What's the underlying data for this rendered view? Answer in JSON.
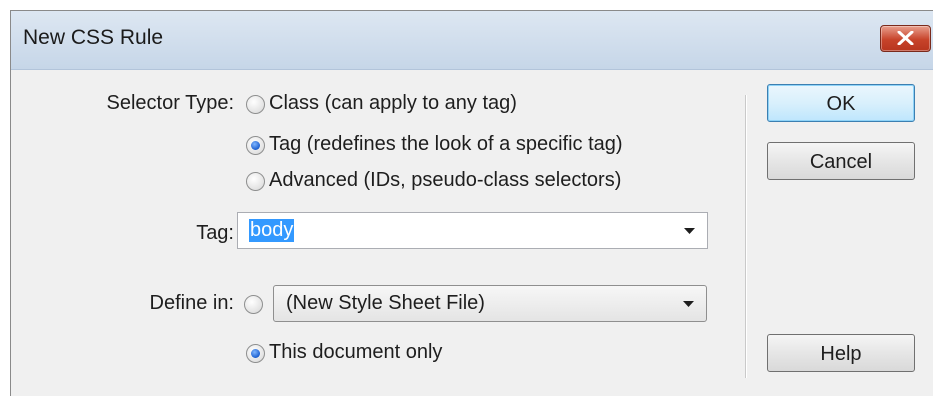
{
  "dialog": {
    "title": "New CSS Rule",
    "close_icon": "close-x-icon",
    "selector_type": {
      "label": "Selector Type:",
      "options": [
        {
          "label": "Class (can apply to any tag)",
          "checked": false
        },
        {
          "label": "Tag (redefines the look of a specific tag)",
          "checked": true
        },
        {
          "label": "Advanced (IDs, pseudo-class selectors)",
          "checked": false
        }
      ]
    },
    "tag": {
      "label": "Tag:",
      "value": "body"
    },
    "define_in": {
      "label": "Define in:",
      "file_option": {
        "value": "(New Style Sheet File)",
        "checked": false
      },
      "document_option": {
        "label": "This document only",
        "checked": true
      }
    },
    "buttons": {
      "ok": "OK",
      "cancel": "Cancel",
      "help": "Help"
    }
  }
}
